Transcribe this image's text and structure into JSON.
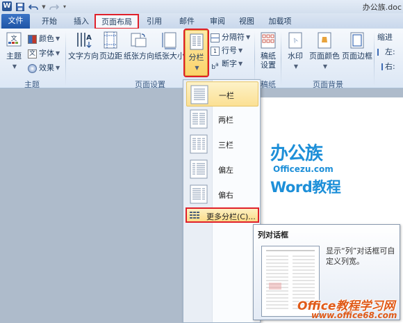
{
  "window": {
    "title": "办公族.doc",
    "app_logo": "W"
  },
  "quick_access": [
    {
      "icon": "save-icon"
    },
    {
      "icon": "undo-icon"
    },
    {
      "icon": "redo-icon"
    },
    {
      "icon": "customize-icon"
    }
  ],
  "tabs": [
    {
      "label": "文件",
      "type": "file"
    },
    {
      "label": "开始"
    },
    {
      "label": "插入"
    },
    {
      "label": "页面布局",
      "active": true
    },
    {
      "label": "引用"
    },
    {
      "label": "邮件"
    },
    {
      "label": "审阅"
    },
    {
      "label": "视图"
    },
    {
      "label": "加载项"
    }
  ],
  "ribbon": {
    "theme_group": {
      "label": "主题",
      "theme_button": "主题",
      "colors": "颜色",
      "fonts": "字体",
      "effects": "效果"
    },
    "page_setup_group": {
      "label": "页面设置",
      "text_direction": "文字方向",
      "margins": "页边距",
      "orientation": "纸张方向",
      "size": "纸张大小",
      "columns": "分栏",
      "breaks": "分隔符",
      "line_numbers": "行号",
      "hyphenation": "断字"
    },
    "manuscript_group": {
      "label": "稿纸",
      "manuscript_setup": "稿纸设置"
    },
    "page_background_group": {
      "label": "页面背景",
      "watermark": "水印",
      "page_color": "页面颜色",
      "page_borders": "页面边框"
    },
    "paragraph_group": {
      "indent": "缩进",
      "left": "左:",
      "right": "右:"
    }
  },
  "columns_menu": {
    "items": [
      {
        "label": "一栏",
        "selected": true
      },
      {
        "label": "两栏"
      },
      {
        "label": "三栏"
      },
      {
        "label": "偏左"
      },
      {
        "label": "偏右"
      }
    ],
    "more": "更多分栏(C)..."
  },
  "tooltip": {
    "title": "列对话框",
    "body": "显示“列”对话框可自定义列宽。"
  },
  "page_logo": {
    "line1": "办公族",
    "line2": "Officezu.com",
    "line3": "Word教程"
  },
  "watermark": {
    "line1": "Office教程学习网",
    "line2": "www.office68.com"
  },
  "colors": {
    "accent_file_tab": "#1f55a6",
    "highlight_border": "#e0202a",
    "logo_blue": "#1d8fd8",
    "watermark_orange": "#e05a18"
  }
}
